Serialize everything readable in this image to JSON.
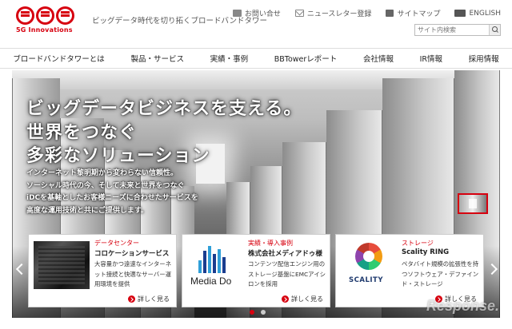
{
  "logo": {
    "subtitle": "5G Innovations"
  },
  "header": {
    "tagline": "ビッグデータ時代を切り拓くブロードバンドタワー",
    "util": [
      {
        "label": "お問い合せ",
        "icon": "phone-icon"
      },
      {
        "label": "ニュースレター登録",
        "icon": "mail-icon"
      },
      {
        "label": "サイトマップ",
        "icon": "sitemap-icon"
      },
      {
        "label": "ENGLISH",
        "icon": "en-icon"
      }
    ],
    "search": {
      "placeholder": "サイト内検索"
    }
  },
  "nav": {
    "items": [
      "ブロードバンドタワーとは",
      "製品・サービス",
      "実績・事例",
      "BBTowerレポート",
      "会社情報",
      "IR情報",
      "採用情報"
    ]
  },
  "hero": {
    "headline1": "ビッグデータビジネスを支える。",
    "headline2": "世界をつなぐ",
    "headline3": "多彩なソリューション",
    "body": [
      "インターネット黎明期から変わらない信頼性。",
      "ソーシャル時代の今、そして未来と世界をつなぐ",
      "iDCを基軸としたお客様ニーズに合わせたサービスを",
      "高度な運用技術と共にご提供します。"
    ]
  },
  "cards": [
    {
      "category": "データセンター",
      "title": "コロケーションサービス",
      "desc": "大容量かつ遠速なインターネット接続と快適なサーバー運用環境を提供",
      "more": "詳しく見る"
    },
    {
      "category": "実績・導入事例",
      "title": "株式会社メディアドゥ様",
      "desc": "コンテンツ配信エンジン用のストレージ基盤にEMCアイシロンを採用",
      "more": "詳しく見る",
      "logo_text": "Media Do"
    },
    {
      "category": "ストレージ",
      "title": "Scality RING",
      "desc": "ペタバイト規模の拡張性を持つソフトウェア・デファインド・ストレージ",
      "more": "詳しく見る",
      "logo_text": "SCALITY"
    }
  ],
  "watermark": "Response.",
  "colors": {
    "accent": "#d7000f"
  }
}
